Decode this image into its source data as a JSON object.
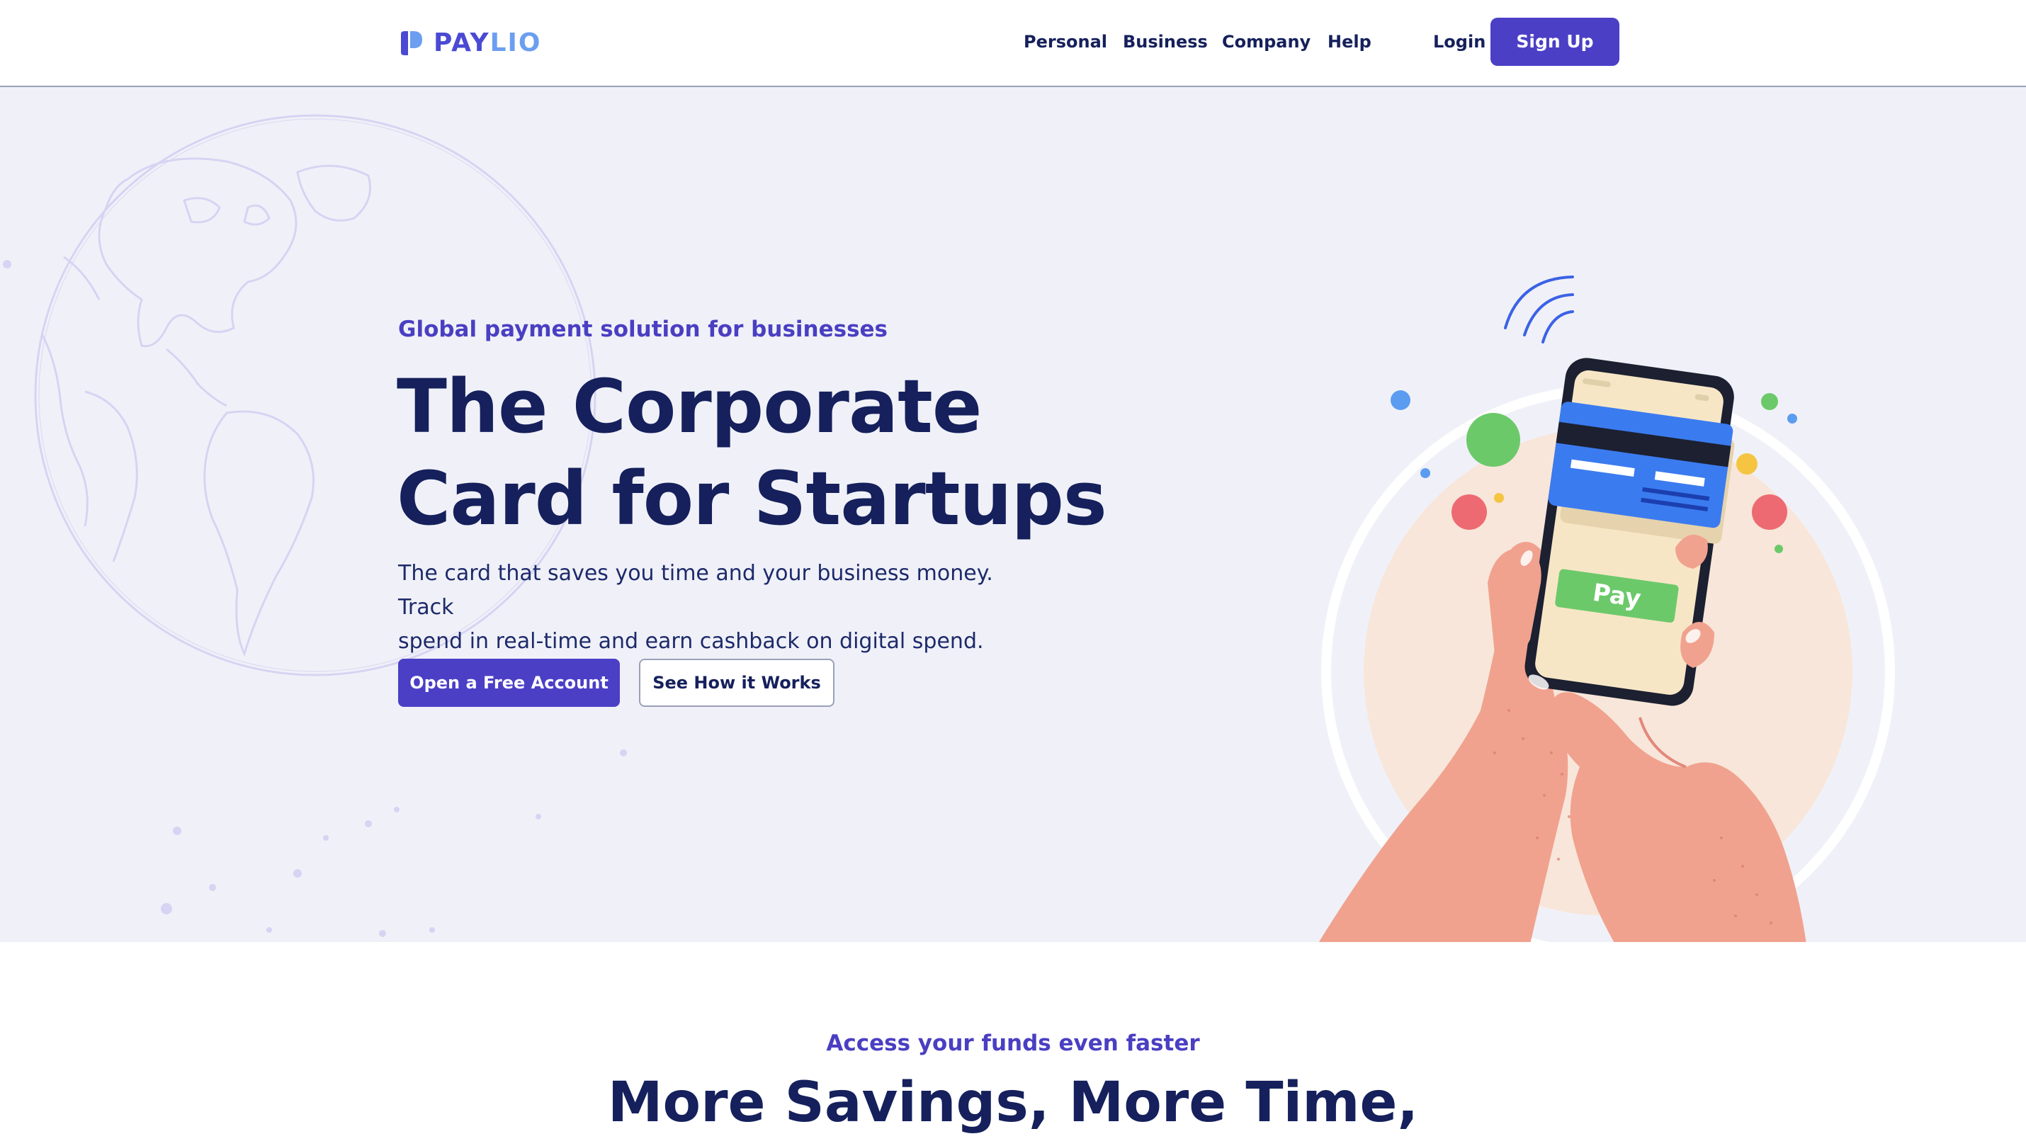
{
  "header": {
    "logo": {
      "part1": "PAY",
      "part2": "LIO"
    },
    "nav": [
      "Personal",
      "Business",
      "Company",
      "Help"
    ],
    "login": "Login",
    "signup": "Sign Up"
  },
  "hero": {
    "eyebrow": "Global payment solution for businesses",
    "title_line1": "The Corporate",
    "title_line2": "Card for Startups",
    "text_line1": "The card that saves you time and your business money. Track",
    "text_line2": "spend in real-time and earn cashback on digital spend.",
    "primary_button": "Open a Free Account",
    "secondary_button": "See How it Works",
    "phone_button": "Pay"
  },
  "section": {
    "eyebrow": "Access your funds even faster",
    "title": "More Savings, More Time,"
  },
  "colors": {
    "brand": "#4b3fc6",
    "navy": "#15205c",
    "hero_bg": "#f0f1f8",
    "card_blue": "#3b7bf0",
    "pay_green": "#6cc96a",
    "skin": "#f0a28e"
  }
}
